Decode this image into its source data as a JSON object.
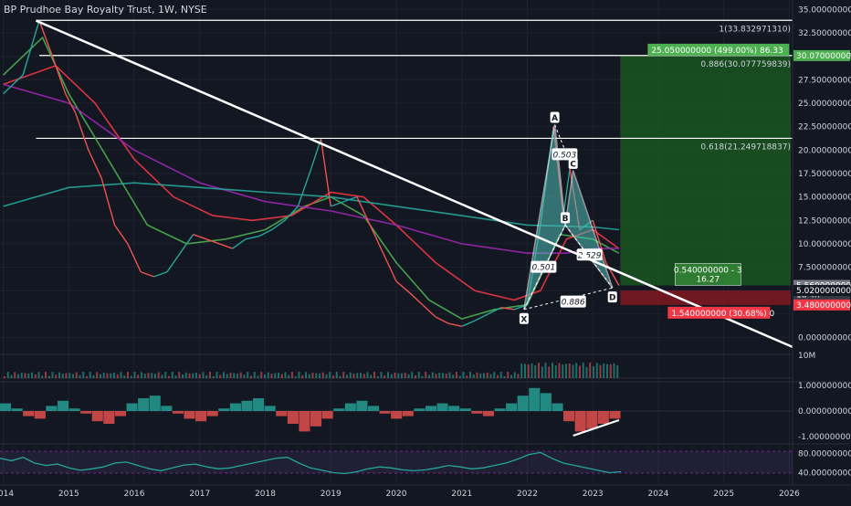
{
  "header": {
    "title": "BP Prudhoe Bay Royalty Trust, 1W, NYSE"
  },
  "colors": {
    "background": "#131722",
    "grid": "#1e222d",
    "price_up": "#26a69a",
    "price_down": "#ef5350",
    "ma_green": "#4caf50",
    "ma_red": "#f23645",
    "ma_purple": "#9c27b0",
    "ma_teal": "#26a69a",
    "pattern_fill": "#4fbcb4",
    "target_green": "#1b5e20",
    "stop_red": "#801922",
    "white_line": "#ffffff"
  },
  "chart_data": {
    "type": "line",
    "x_axis": {
      "ticks": [
        "2014",
        "2015",
        "2016",
        "2017",
        "2018",
        "2019",
        "2020",
        "2021",
        "2022",
        "2023",
        "2024",
        "2025",
        "2026"
      ],
      "range": [
        2013.95,
        2026.05
      ]
    },
    "y_axis": {
      "ticks": [
        "35.000000000",
        "32.500000000",
        "30.000000000",
        "27.500000000",
        "25.000000000",
        "22.500000000",
        "20.000000000",
        "17.500000000",
        "15.000000000",
        "12.500000000",
        "10.000000000",
        "7.500000000",
        "5.560000000",
        "5.020000000",
        "3.480000000",
        "0.000000000"
      ],
      "range": [
        -1.5,
        36
      ]
    },
    "price_series": {
      "name": "",
      "x": [
        2014.0,
        2014.3,
        2014.55,
        2014.75,
        2014.95,
        2015.1,
        2015.3,
        2015.5,
        2015.7,
        2015.9,
        2016.1,
        2016.3,
        2016.5,
        2016.7,
        2016.9,
        2017.1,
        2017.3,
        2017.5,
        2017.7,
        2017.9,
        2018.1,
        2018.3,
        2018.5,
        2018.7,
        2018.85,
        2019.0,
        2019.2,
        2019.4,
        2019.6,
        2019.8,
        2020.0,
        2020.2,
        2020.4,
        2020.6,
        2020.8,
        2021.0,
        2021.2,
        2021.4,
        2021.6,
        2021.8,
        2022.0,
        2022.2,
        2022.4,
        2022.55,
        2022.65,
        2022.8,
        2023.0,
        2023.2,
        2023.4
      ],
      "y": [
        26.0,
        28.0,
        33.8,
        30.0,
        26.0,
        24.0,
        20.0,
        17.0,
        12.0,
        10.0,
        7.0,
        6.5,
        7.0,
        9.0,
        11.0,
        10.5,
        10.0,
        9.5,
        10.5,
        10.8,
        11.5,
        12.5,
        14.0,
        18.0,
        21.2,
        14.0,
        14.5,
        15.0,
        12.0,
        9.0,
        6.0,
        4.8,
        3.5,
        2.2,
        1.5,
        1.2,
        1.8,
        2.5,
        3.2,
        3.0,
        3.48,
        12.0,
        22.5,
        13.0,
        18.0,
        11.5,
        12.5,
        8.0,
        5.56
      ]
    },
    "moving_averages": [
      {
        "color": "#4caf50",
        "x": [
          2014.0,
          2014.6,
          2015.0,
          2015.6,
          2016.2,
          2016.8,
          2017.4,
          2018.0,
          2018.6,
          2019.0,
          2019.5,
          2020.0,
          2020.5,
          2021.0,
          2021.5,
          2022.0,
          2022.5,
          2023.0,
          2023.4
        ],
        "y": [
          28,
          32,
          26,
          19,
          12,
          10,
          10.5,
          11.5,
          14,
          15,
          13,
          8,
          4,
          2,
          3,
          3.5,
          11,
          10.5,
          9
        ]
      },
      {
        "color": "#f23645",
        "x": [
          2014.0,
          2014.8,
          2015.4,
          2016.0,
          2016.6,
          2017.2,
          2017.8,
          2018.4,
          2019.0,
          2019.5,
          2020.0,
          2020.6,
          2021.2,
          2021.8,
          2022.2,
          2022.6,
          2023.0,
          2023.4
        ],
        "y": [
          27,
          29,
          25,
          19,
          15,
          13,
          12.5,
          13,
          15.5,
          15,
          12,
          8,
          5,
          4,
          5,
          10.5,
          11.5,
          9.5
        ]
      },
      {
        "color": "#9c27b0",
        "x": [
          2014.0,
          2015.0,
          2016.0,
          2017.0,
          2018.0,
          2019.0,
          2020.0,
          2021.0,
          2022.0,
          2022.6,
          2023.0,
          2023.4
        ],
        "y": [
          27,
          25,
          20,
          16.5,
          14.5,
          13.5,
          12,
          10,
          9,
          9,
          9.5,
          9.5
        ]
      },
      {
        "color": "#26a69a",
        "x": [
          2014.0,
          2015.0,
          2016.0,
          2017.0,
          2018.0,
          2019.0,
          2020.0,
          2021.0,
          2022.0,
          2023.0,
          2023.4
        ],
        "y": [
          14,
          16,
          16.5,
          16,
          15.5,
          15,
          14,
          13,
          12,
          11.8,
          11.5
        ]
      }
    ],
    "fib_levels": [
      {
        "label": "1(33.832971310)",
        "value": 33.83
      },
      {
        "label": "0.886(30.077759839)",
        "value": 30.08
      },
      {
        "label": "0.618(21.249718837)",
        "value": 21.25
      }
    ],
    "trendline": {
      "from": [
        2014.5,
        33.8
      ],
      "to": [
        2026.05,
        -1.0
      ]
    },
    "harmonic_pattern": {
      "points": [
        {
          "label": "X",
          "x": 2021.95,
          "y": 3.0
        },
        {
          "label": "A",
          "x": 2022.42,
          "y": 22.7
        },
        {
          "label": "B",
          "x": 2022.58,
          "y": 12.0
        },
        {
          "label": "C",
          "x": 2022.7,
          "y": 17.8
        },
        {
          "label": "D",
          "x": 2023.3,
          "y": 5.3
        }
      ],
      "ratios": [
        {
          "label": "0.503",
          "x": 2022.57,
          "y": 19.5
        },
        {
          "label": "2.529",
          "x": 2022.95,
          "y": 8.8
        },
        {
          "label": "0.501",
          "x": 2022.25,
          "y": 7.5
        },
        {
          "label": "0.886",
          "x": 2022.7,
          "y": 3.8
        }
      ]
    },
    "target_box": {
      "label": "25.050000000 (499.00%) 86.33",
      "top": 30.07,
      "bottom": 5.56
    },
    "stop_box": {
      "label": "1.540000000 (30.68%) 0",
      "top": 5.02,
      "bottom": 3.48
    },
    "entry_label": [
      "0.540000000 - 3",
      "16.27"
    ],
    "price_badges": [
      {
        "text": "30.070000000",
        "value": 30.07,
        "bg": "#4caf50"
      },
      {
        "text": "5.560000000",
        "value": 5.56,
        "bg": "#787b86"
      },
      {
        "text": "1d 4h",
        "value": 4.6,
        "bg": "#363a45"
      },
      {
        "text": "5.020000000",
        "value": 5.02,
        "bg": "#131722"
      },
      {
        "text": "3.480000000",
        "value": 3.48,
        "bg": "#f23645"
      }
    ],
    "volume_label": "10M",
    "oscillator": {
      "ticks": [
        "1.000000000",
        "0.000000000",
        "-1.000000000"
      ],
      "values": [
        0.3,
        0.1,
        -0.2,
        -0.3,
        0.2,
        0.4,
        0.1,
        -0.1,
        -0.4,
        -0.5,
        -0.2,
        0.3,
        0.5,
        0.6,
        0.2,
        -0.1,
        -0.3,
        -0.4,
        -0.2,
        0.1,
        0.3,
        0.4,
        0.5,
        0.2,
        -0.2,
        -0.5,
        -0.8,
        -0.6,
        -0.3,
        0.1,
        0.3,
        0.4,
        0.2,
        -0.1,
        -0.3,
        -0.2,
        0.1,
        0.2,
        0.3,
        0.2,
        0.1,
        -0.1,
        -0.2,
        0.1,
        0.3,
        0.6,
        0.9,
        0.7,
        0.3,
        -0.4,
        -0.8,
        -0.7,
        -0.5,
        -0.3
      ]
    },
    "rsi": {
      "ticks": [
        "80.000000000",
        "40.000000000"
      ],
      "values": [
        70,
        65,
        72,
        60,
        55,
        58,
        50,
        45,
        48,
        52,
        60,
        62,
        55,
        48,
        44,
        50,
        56,
        58,
        52,
        48,
        50,
        55,
        60,
        65,
        70,
        72,
        60,
        50,
        45,
        40,
        38,
        42,
        48,
        52,
        50,
        46,
        44,
        46,
        50,
        55,
        52,
        48,
        50,
        55,
        60,
        68,
        78,
        82,
        70,
        60,
        55,
        50,
        45,
        40,
        42
      ]
    }
  }
}
